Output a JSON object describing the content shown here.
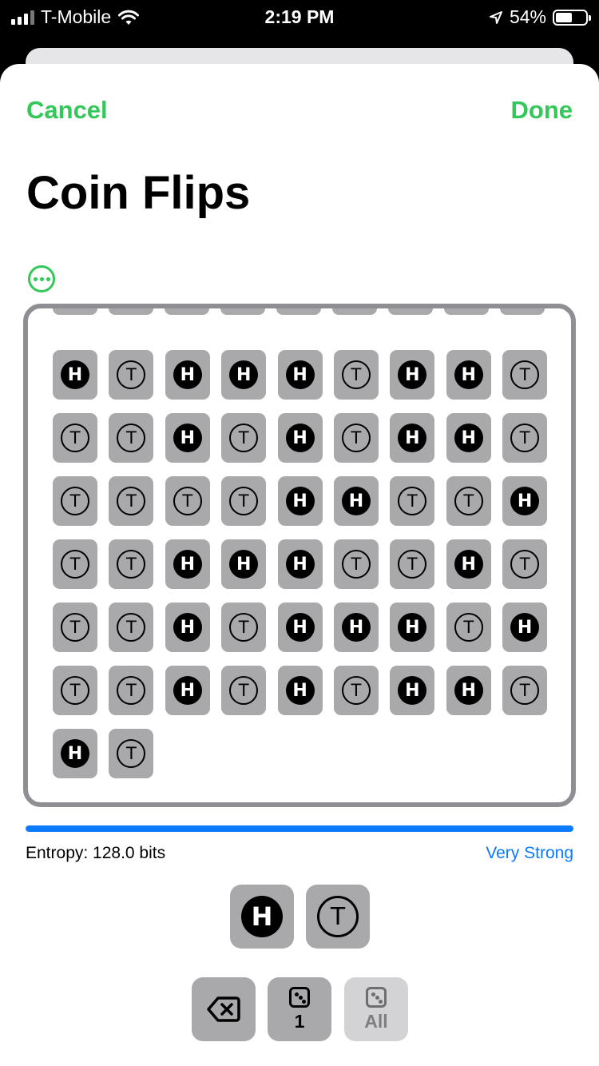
{
  "status_bar": {
    "carrier": "T-Mobile",
    "time": "2:19 PM",
    "battery_percent": "54%",
    "icons": [
      "signal-icon",
      "wifi-icon",
      "location-arrow-icon",
      "battery-icon"
    ]
  },
  "nav": {
    "cancel_label": "Cancel",
    "done_label": "Done"
  },
  "title": "Coin Flips",
  "more_icon": "ellipsis-circle-icon",
  "flips": [
    [
      "H",
      "T",
      "H",
      "H",
      "H",
      "T",
      "H",
      "H",
      "T"
    ],
    [
      "T",
      "T",
      "H",
      "T",
      "H",
      "T",
      "H",
      "H",
      "T"
    ],
    [
      "T",
      "T",
      "T",
      "T",
      "H",
      "H",
      "T",
      "T",
      "H"
    ],
    [
      "T",
      "T",
      "H",
      "H",
      "H",
      "T",
      "T",
      "H",
      "T"
    ],
    [
      "T",
      "T",
      "H",
      "T",
      "H",
      "H",
      "H",
      "T",
      "H"
    ],
    [
      "T",
      "T",
      "H",
      "T",
      "H",
      "T",
      "H",
      "H",
      "T"
    ],
    [
      "H",
      "T"
    ]
  ],
  "entropy": {
    "label": "Entropy: 128.0 bits",
    "strength": "Very Strong",
    "progress": 1.0
  },
  "coin_buttons": [
    {
      "name": "heads",
      "glyph": "H"
    },
    {
      "name": "tails",
      "glyph": "T"
    }
  ],
  "actions": {
    "delete_icon": "backspace-icon",
    "roll_one_label": "1",
    "roll_all_label": "All",
    "die_icon": "dice-icon"
  },
  "colors": {
    "accent_green": "#34c759",
    "link_blue": "#0a7aff",
    "tile_gray": "#a9a9ab",
    "border_gray": "#8e8e93"
  }
}
